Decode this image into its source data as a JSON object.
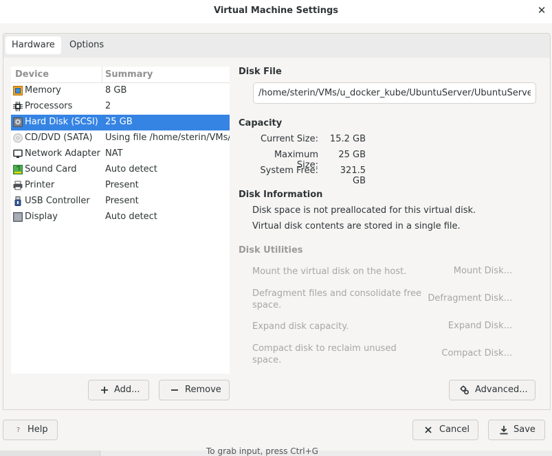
{
  "window": {
    "title": "Virtual Machine Settings"
  },
  "tabs": [
    {
      "label": "Hardware",
      "active": true
    },
    {
      "label": "Options",
      "active": false
    }
  ],
  "devices": {
    "headers": {
      "device": "Device",
      "summary": "Summary"
    },
    "rows": [
      {
        "name": "Memory",
        "summary": "8 GB",
        "icon": "memory-icon"
      },
      {
        "name": "Processors",
        "summary": "2",
        "icon": "processor-icon"
      },
      {
        "name": "Hard Disk (SCSI)",
        "summary": "25 GB",
        "icon": "hard-disk-icon",
        "selected": true
      },
      {
        "name": "CD/DVD (SATA)",
        "summary": "Using file /home/sterin/VMs/",
        "icon": "cd-dvd-icon"
      },
      {
        "name": "Network Adapter",
        "summary": "NAT",
        "icon": "network-adapter-icon"
      },
      {
        "name": "Sound Card",
        "summary": "Auto detect",
        "icon": "sound-card-icon"
      },
      {
        "name": "Printer",
        "summary": "Present",
        "icon": "printer-icon"
      },
      {
        "name": "USB Controller",
        "summary": "Present",
        "icon": "usb-icon"
      },
      {
        "name": "Display",
        "summary": "Auto detect",
        "icon": "display-icon"
      }
    ],
    "add_label": "Add...",
    "remove_label": "Remove"
  },
  "disk_file": {
    "heading": "Disk File",
    "value": "/home/sterin/VMs/u_docker_kube/UbuntuServer/UbuntuServer.vmdk"
  },
  "capacity": {
    "heading": "Capacity",
    "current_label": "Current Size:",
    "current_value": "15.2 GB",
    "max_label": "Maximum Size:",
    "max_value": "25 GB",
    "free_label": "System Free:",
    "free_value": "321.5 GB"
  },
  "disk_info": {
    "heading": "Disk Information",
    "line1": "Disk space is not preallocated for this virtual disk.",
    "line2": "Virtual disk contents are stored in a single file."
  },
  "utilities": {
    "heading": "Disk Utilities",
    "items": [
      {
        "description": "Mount the virtual disk on the host.",
        "button": "Mount Disk..."
      },
      {
        "description": "Defragment files and consolidate free space.",
        "button": "Defragment Disk..."
      },
      {
        "description": "Expand disk capacity.",
        "button": "Expand Disk..."
      },
      {
        "description": "Compact disk to reclaim unused space.",
        "button": "Compact Disk..."
      }
    ]
  },
  "advanced_label": "Advanced...",
  "footer": {
    "help": "Help",
    "cancel": "Cancel",
    "save": "Save"
  },
  "background_hint": "To grab input, press Ctrl+G"
}
